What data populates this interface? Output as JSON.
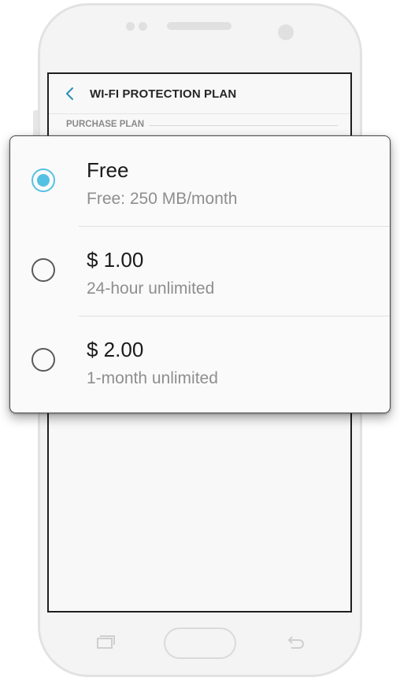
{
  "header": {
    "title": "WI-FI PROTECTION PLAN",
    "back_icon": "chevron-left-icon",
    "accent": "#2b8fb5"
  },
  "section": {
    "label": "PURCHASE PLAN"
  },
  "plans": [
    {
      "title": "Free",
      "subtitle": "Free: 250 MB/month",
      "selected": true
    },
    {
      "title": "$ 1.00",
      "subtitle": "24-hour unlimited",
      "selected": false
    },
    {
      "title": "$ 2.00",
      "subtitle": "1-month unlimited",
      "selected": false
    }
  ],
  "colors": {
    "radio_selected": "#54c1e3",
    "radio_unselected": "#5a5a5a"
  },
  "device": {
    "keys": [
      "recent-apps-icon",
      "home-button",
      "back-arrow-icon"
    ]
  }
}
